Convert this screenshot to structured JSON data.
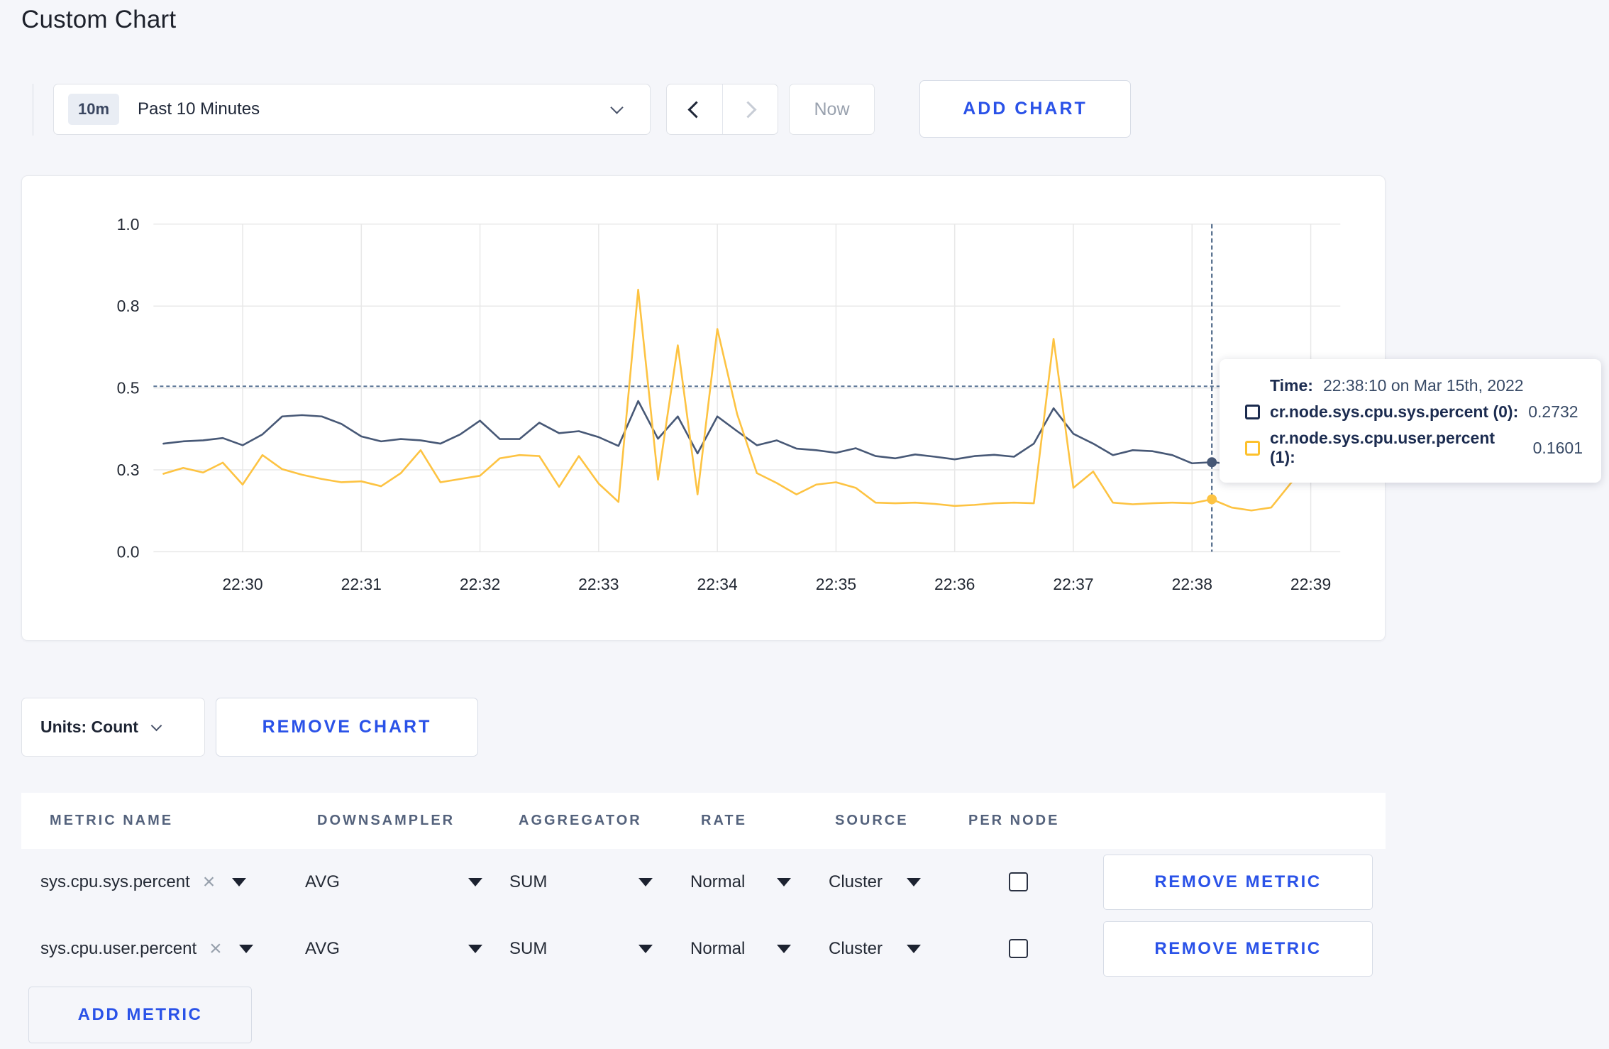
{
  "page": {
    "title": "Custom Chart"
  },
  "toolbar": {
    "time_range": {
      "badge": "10m",
      "label": "Past 10 Minutes"
    },
    "now_label": "Now",
    "add_chart_label": "ADD CHART"
  },
  "chart_data": {
    "type": "line",
    "title": "",
    "xlabel": "",
    "ylabel": "",
    "ylim": [
      0,
      1
    ],
    "grid": true,
    "x_tick_labels": [
      "22:30",
      "22:31",
      "22:32",
      "22:33",
      "22:34",
      "22:35",
      "22:36",
      "22:37",
      "22:38",
      "22:39"
    ],
    "y_tick_values": [
      0,
      0.25,
      0.5,
      0.75,
      1.0
    ],
    "y_tick_labels": [
      "0.0",
      "0.3",
      "0.5",
      "0.8",
      "1.0"
    ],
    "x_start_time": "22:29:20",
    "x_step_seconds": 10,
    "series": [
      {
        "name": "cr.node.sys.cpu.sys.percent",
        "color": "#475876",
        "values": [
          0.33,
          0.337,
          0.34,
          0.347,
          0.325,
          0.358,
          0.413,
          0.417,
          0.413,
          0.39,
          0.352,
          0.337,
          0.344,
          0.34,
          0.33,
          0.358,
          0.4,
          0.344,
          0.344,
          0.394,
          0.362,
          0.368,
          0.35,
          0.323,
          0.46,
          0.345,
          0.413,
          0.3,
          0.413,
          0.368,
          0.325,
          0.34,
          0.315,
          0.31,
          0.302,
          0.316,
          0.292,
          0.285,
          0.297,
          0.29,
          0.282,
          0.292,
          0.296,
          0.29,
          0.33,
          0.438,
          0.36,
          0.33,
          0.295,
          0.31,
          0.307,
          0.295,
          0.27,
          0.2732,
          0.268,
          0.262,
          0.27,
          0.295,
          0.3,
          0.292
        ]
      },
      {
        "name": "cr.node.sys.cpu.user.percent",
        "color": "#fdc342",
        "values": [
          0.238,
          0.256,
          0.242,
          0.272,
          0.205,
          0.295,
          0.252,
          0.235,
          0.222,
          0.212,
          0.215,
          0.2,
          0.24,
          0.31,
          0.212,
          0.222,
          0.232,
          0.285,
          0.295,
          0.292,
          0.198,
          0.292,
          0.208,
          0.152,
          0.8,
          0.22,
          0.63,
          0.175,
          0.68,
          0.42,
          0.24,
          0.21,
          0.175,
          0.205,
          0.212,
          0.195,
          0.15,
          0.148,
          0.15,
          0.146,
          0.14,
          0.143,
          0.148,
          0.15,
          0.148,
          0.65,
          0.195,
          0.245,
          0.15,
          0.145,
          0.148,
          0.15,
          0.148,
          0.1601,
          0.135,
          0.126,
          0.135,
          0.21,
          0.278,
          0.225
        ]
      }
    ],
    "crosshair": {
      "snap_index": 53,
      "time": "22:38:10",
      "mouse_y_value": 0.505
    },
    "legend_position": "tooltip"
  },
  "tooltip": {
    "time_label": "Time:",
    "time_value": "22:38:10 on Mar 15th, 2022",
    "rows": [
      {
        "label": "cr.node.sys.cpu.sys.percent (0):",
        "value": "0.2732",
        "swatch_color": "#1b2b4e"
      },
      {
        "label": "cr.node.sys.cpu.user.percent (1):",
        "value": "0.1601",
        "swatch_color": "#fdc12c"
      }
    ]
  },
  "units_bar": {
    "units_label": "Units: Count",
    "remove_chart_label": "REMOVE CHART"
  },
  "metrics_table": {
    "headers": {
      "metric": "METRIC NAME",
      "downsampler": "DOWNSAMPLER",
      "aggregator": "AGGREGATOR",
      "rate": "RATE",
      "source": "SOURCE",
      "per_node": "PER NODE"
    },
    "rows": [
      {
        "metric": "sys.cpu.sys.percent",
        "downsampler": "AVG",
        "aggregator": "SUM",
        "rate": "Normal",
        "source": "Cluster",
        "per_node_checked": false,
        "remove_label": "REMOVE METRIC"
      },
      {
        "metric": "sys.cpu.user.percent",
        "downsampler": "AVG",
        "aggregator": "SUM",
        "rate": "Normal",
        "source": "Cluster",
        "per_node_checked": false,
        "remove_label": "REMOVE METRIC"
      }
    ],
    "add_metric_label": "ADD METRIC"
  },
  "colors": {
    "accent_blue": "#2a52e8",
    "grid": "#e8e8e8",
    "crosshair": "#3e5a7e",
    "axis_text": "#242a35",
    "page_bg": "#f5f6fa"
  }
}
